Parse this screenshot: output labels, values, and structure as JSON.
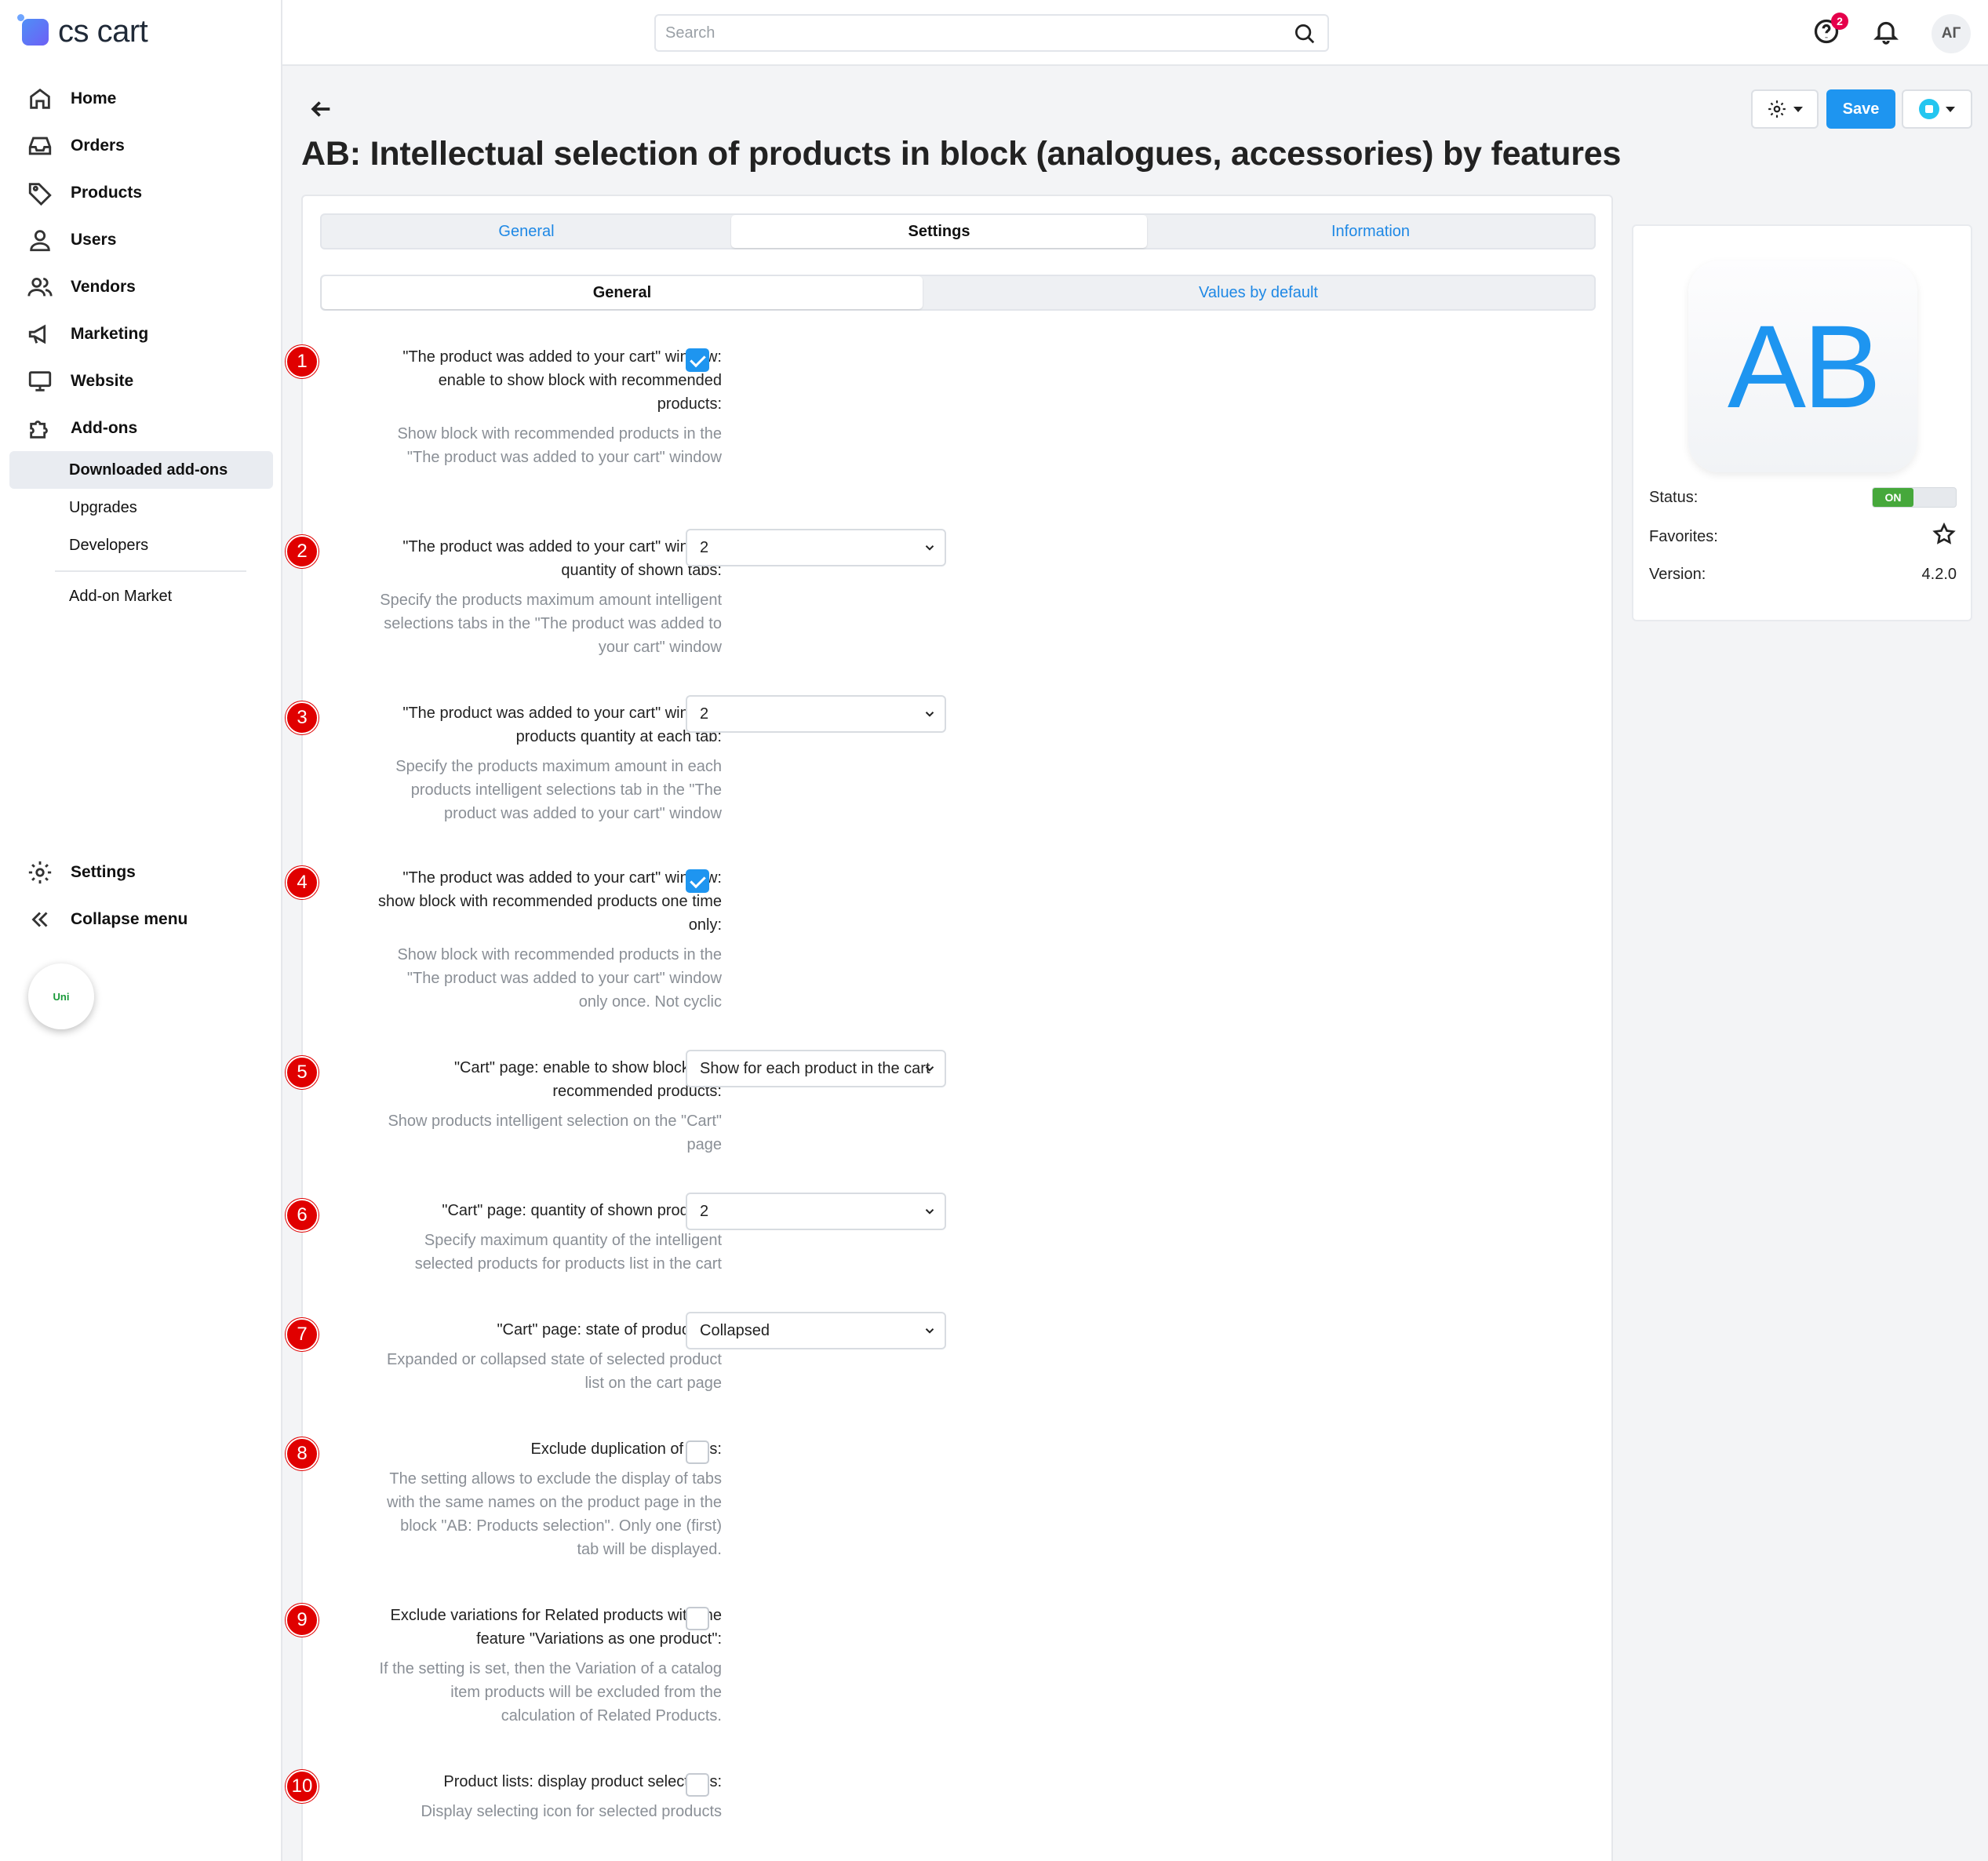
{
  "brand": {
    "name": "cs cart"
  },
  "search": {
    "placeholder": "Search"
  },
  "header": {
    "notifications_count": "2",
    "avatar_initials": "АГ"
  },
  "sidebar": {
    "items": [
      {
        "label": "Home",
        "icon": "home-icon"
      },
      {
        "label": "Orders",
        "icon": "inbox-icon"
      },
      {
        "label": "Products",
        "icon": "tag-icon"
      },
      {
        "label": "Users",
        "icon": "user-icon"
      },
      {
        "label": "Vendors",
        "icon": "users-icon"
      },
      {
        "label": "Marketing",
        "icon": "megaphone-icon"
      },
      {
        "label": "Website",
        "icon": "monitor-icon"
      },
      {
        "label": "Add-ons",
        "icon": "puzzle-icon"
      }
    ],
    "subitems": [
      "Downloaded add-ons",
      "Upgrades",
      "Developers",
      "Add-on Market"
    ],
    "settings_label": "Settings",
    "collapse_label": "Collapse menu",
    "uni_label": "Uni"
  },
  "toolbar": {
    "save_label": "Save"
  },
  "page": {
    "title": "AB: Intellectual selection of products in block (analogues, accessories) by features"
  },
  "tabs": [
    "General",
    "Settings",
    "Information"
  ],
  "subtabs": [
    "General",
    "Values by default"
  ],
  "settings": [
    {
      "num": "1",
      "label": "\"The product was added to your cart\" window: enable to show block with recommended products:",
      "desc": "Show block with recommended products in the \"The product was added to your cart\" window",
      "control": "checkbox",
      "checked": true
    },
    {
      "num": "2",
      "label": "\"The product was added to your cart\" window: quantity of shown tabs:",
      "desc": "Specify the products maximum amount intelligent selections tabs in the \"The product was added to your cart\" window",
      "control": "select",
      "value": "2"
    },
    {
      "num": "3",
      "label": "\"The product was added to your cart\" window: products quantity at each tab:",
      "desc": "Specify the products maximum amount in each products intelligent selections tab in the \"The product was added to your cart\" window",
      "control": "select",
      "value": "2"
    },
    {
      "num": "4",
      "label": "\"The product was added to your cart\" window: show block with recommended products one time only:",
      "desc": "Show block with recommended products in the \"The product was added to your cart\" window only once. Not cyclic",
      "control": "checkbox",
      "checked": true
    },
    {
      "num": "5",
      "label": "\"Cart\" page: enable to show block with recommended products:",
      "desc": "Show products intelligent selection on the \"Cart\" page",
      "control": "select",
      "value": "Show for each product in the cart"
    },
    {
      "num": "6",
      "label": "\"Cart\" page: quantity of shown products:",
      "desc": "Specify maximum quantity of the intelligent selected products for products list in the cart",
      "control": "select",
      "value": "2"
    },
    {
      "num": "7",
      "label": "\"Cart\" page: state of product list:",
      "desc": "Expanded or collapsed state of selected product list on the cart page",
      "control": "select",
      "value": "Collapsed"
    },
    {
      "num": "8",
      "label": "Exclude duplication of tabs:",
      "desc": "The setting allows to exclude the display of tabs with the same names on the product page in the block \"AB: Products selection\". Only one (first) tab will be displayed.",
      "control": "checkbox",
      "checked": false
    },
    {
      "num": "9",
      "label": "Exclude variations for Related products with the feature \"Variations as one product\":",
      "desc": "If the setting is set, then the Variation of a catalog item products will be excluded from the calculation of Related Products.",
      "control": "checkbox",
      "checked": false
    },
    {
      "num": "10",
      "label": "Product lists: display product selections:",
      "desc": "Display selecting icon for selected products",
      "control": "checkbox",
      "checked": false
    }
  ],
  "addon_card": {
    "logo_text": "AB",
    "status_label": "Status:",
    "status_value": "ON",
    "favorites_label": "Favorites:",
    "version_label": "Version:",
    "version_value": "4.2.0"
  },
  "colors": {
    "accent": "#1e95f0",
    "marker": "#e00000",
    "status_on": "#46a83b"
  }
}
